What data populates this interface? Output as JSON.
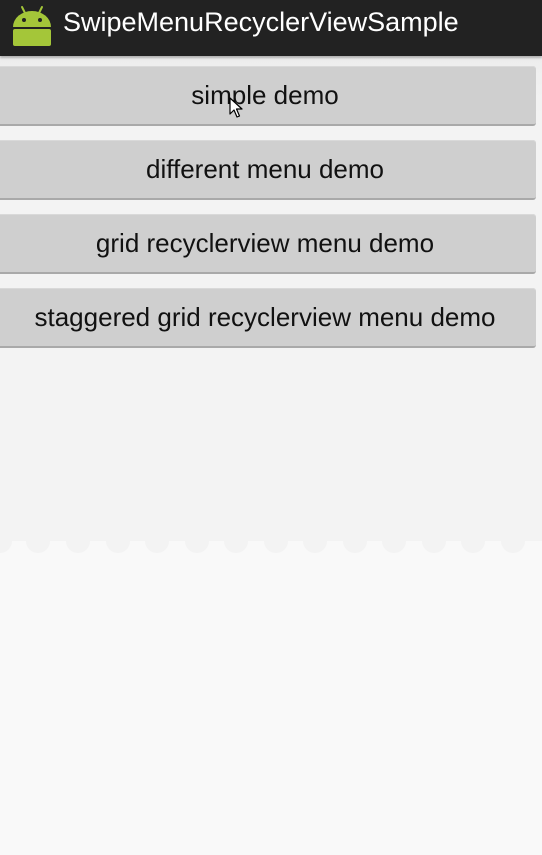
{
  "app_bar": {
    "title": "SwipeMenuRecyclerViewSample",
    "icon": "android-robot-icon",
    "background_color": "#222222",
    "icon_color": "#a4c639"
  },
  "buttons": [
    {
      "label": "simple demo"
    },
    {
      "label": "different menu demo"
    },
    {
      "label": "grid recyclerview menu demo"
    },
    {
      "label": "staggered grid recyclerview menu demo"
    }
  ],
  "colors": {
    "button_background": "#cfcfcf",
    "content_background": "#f3f3f3",
    "page_background": "#f9f9f9"
  },
  "pointer": "mouse-cursor-icon"
}
